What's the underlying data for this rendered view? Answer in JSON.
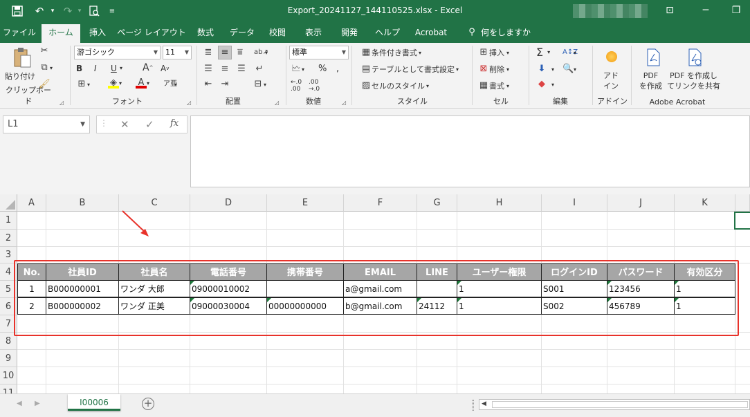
{
  "window": {
    "title": "Export_20241127_144110525.xlsx  -  Excel",
    "quick_access": {
      "save": "save-icon",
      "undo": "undo-icon",
      "redo": "redo-icon",
      "preview": "print-preview-icon"
    }
  },
  "tabs": [
    "ファイル",
    "ホーム",
    "挿入",
    "ページ レイアウト",
    "数式",
    "データ",
    "校閲",
    "表示",
    "開発",
    "ヘルプ",
    "Acrobat",
    "何をしますか"
  ],
  "active_tab": "ホーム",
  "ribbon": {
    "clipboard": {
      "paste": "貼り付け",
      "label": "クリップボード"
    },
    "font": {
      "name": "游ゴシック",
      "size": "11",
      "label": "フォント",
      "bold": "B",
      "italic": "I",
      "underline": "U"
    },
    "alignment": {
      "label": "配置"
    },
    "number": {
      "format": "標準",
      "label": "数値"
    },
    "styles": {
      "conditional": "条件付き書式",
      "table": "テーブルとして書式設定",
      "cell_styles": "セルのスタイル",
      "label": "スタイル"
    },
    "cells": {
      "insert": "挿入",
      "delete": "削除",
      "format": "書式",
      "label": "セル"
    },
    "editing": {
      "label": "編集"
    },
    "addins": {
      "button": "アド\nイン",
      "label": "アドイン"
    },
    "acrobat": {
      "create_pdf": "PDF\nを作成",
      "share_pdf": "PDF を作成し\nてリンクを共有",
      "label": "Adobe Acrobat"
    }
  },
  "name_box": "L1",
  "columns": [
    "A",
    "B",
    "C",
    "D",
    "E",
    "F",
    "G",
    "H",
    "I",
    "J",
    "K"
  ],
  "rows": [
    "1",
    "2",
    "3",
    "4",
    "5",
    "6",
    "7",
    "8",
    "9",
    "10",
    "11"
  ],
  "table": {
    "headers": [
      "No.",
      "社員ID",
      "社員名",
      "電話番号",
      "携帯番号",
      "EMAIL",
      "LINE",
      "ユーザー権限",
      "ログインID",
      "パスワード",
      "有効区分"
    ],
    "rows": [
      [
        "1",
        "B000000001",
        "ワンダ 大郎",
        "09000010002",
        "",
        "a@gmail.com",
        "",
        "1",
        "S001",
        "123456",
        "1"
      ],
      [
        "2",
        "B000000002",
        "ワンダ 正美",
        "09000030004",
        "00000000000",
        "b@gmail.com",
        "24112",
        "1",
        "S002",
        "456789",
        "1"
      ]
    ]
  },
  "sheet_tab": "I00006",
  "colors": {
    "excel_green": "#217346",
    "header_fill": "#a6a6a6",
    "highlight": "#e8322a"
  }
}
